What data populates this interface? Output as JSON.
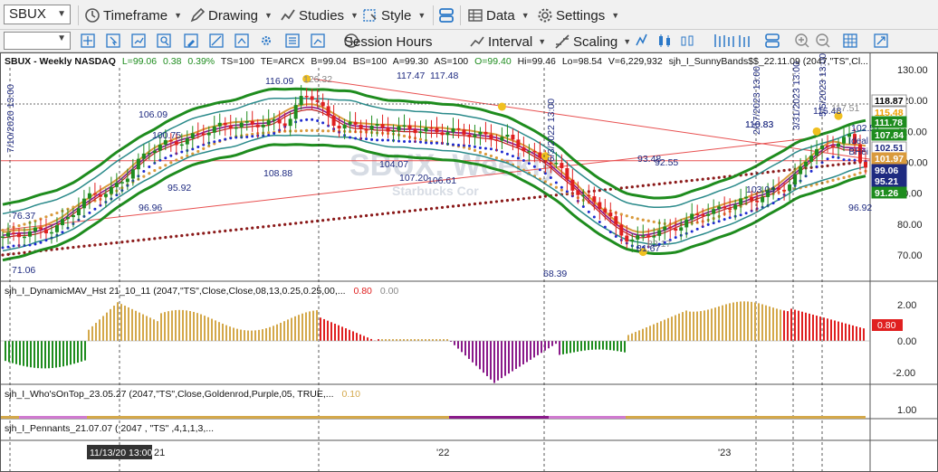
{
  "toolbar": {
    "symbol": "SBUX",
    "timeframe": "Timeframe",
    "drawing": "Drawing",
    "studies": "Studies",
    "style": "Style",
    "data": "Data",
    "settings": "Settings",
    "session_hours": "Session Hours",
    "interval": "Interval",
    "scaling": "Scaling"
  },
  "header": {
    "symbol": "SBUX - Weekly  NASDAQ",
    "L": "L=99.06",
    "chg": "0.38",
    "pct": "0.39%",
    "ts": "TS=100",
    "te": "TE=ARCX",
    "b": "B=99.04",
    "bs": "BS=100",
    "a": "A=99.30",
    "as": "AS=100",
    "o": "O=99.40",
    "hi": "Hi=99.46",
    "lo": "Lo=98.54",
    "v": "V=6,229,932",
    "study": "sjh_I_SunnyBands$$_22.11.09 (2047,\"TS\",Cl..."
  },
  "watermark": {
    "symbol": "SBUX, Weekly",
    "name": "Starbucks Cor"
  },
  "price_axis": {
    "ticks": [
      "130.00",
      "120.00",
      "110.00",
      "100.00",
      "90.00",
      "80.00",
      "70.00"
    ],
    "badges": [
      {
        "value": "118.87",
        "bg": "#ffffff",
        "fg": "#000000"
      },
      {
        "value": "115.48",
        "bg": "#ffffff",
        "fg": "#f0a000"
      },
      {
        "value": "111.78",
        "bg": "#1e8c1e",
        "fg": "#ffffff"
      },
      {
        "value": "107.84",
        "bg": "#1e8c1e",
        "fg": "#ffffff"
      },
      {
        "value": "102.51",
        "bg": "#ffffff",
        "fg": "#1e2a80"
      },
      {
        "value": "101.97",
        "bg": "#d99a3c",
        "fg": "#ffffff"
      },
      {
        "value": "99.06",
        "bg": "#1e2a80",
        "fg": "#ffffff"
      },
      {
        "value": "95.21",
        "bg": "#1e2a80",
        "fg": "#ffffff"
      },
      {
        "value": "91.26",
        "bg": "#1e8c1e",
        "fg": "#ffffff"
      }
    ]
  },
  "annotations": {
    "price_labels": [
      "126.32",
      "116.09",
      "117.47",
      "117.48",
      "106.09",
      "100.75",
      "95.92",
      "96.96",
      "76.37",
      "71.06",
      "108.88",
      "107.20",
      "106.61",
      "104.07",
      "68.39",
      "83.17",
      "81.67",
      "93.48",
      "92.55",
      "110.83",
      "110.83",
      "103.04",
      "115.48",
      "102.51",
      "96.92",
      "117.51"
    ],
    "date_labels": [
      "7/10/2020 13:00",
      "6/3/2022 13:00",
      "2/17/2023 13:00",
      "3/31/2023 13:00",
      "5/5/2023 13:00"
    ],
    "note": "Ideal",
    "note2": "BHei"
  },
  "panels": {
    "dynamic_mav": {
      "title": "sjh_I_DynamicMAV_Hst 21_10_11 (2047,\"TS\",Close,Close,08,13,0.25,0.25,00,...",
      "v1": "0.80",
      "v2": "0.00",
      "ticks": [
        "2.00",
        "0.00",
        "-2.00"
      ],
      "badge": "0.80"
    },
    "whos_on_top": {
      "title": "sjh_I_Who'sOnTop_23.05.27 (2047,\"TS\",Close,Goldenrod,Purple,05,  TRUE,...",
      "v1": "0.10",
      "ticks": [
        "1.00"
      ]
    },
    "pennants": {
      "title": "sjh_I_Pennants_21.07.07 ( 2047 , \"TS\" ,4,1,1,3,..."
    }
  },
  "time_axis": {
    "cursor_label": "11/13/20 13:00",
    "labels": [
      "21",
      "'22",
      "'23"
    ]
  },
  "colors": {
    "green_band": "#1e8c1e",
    "teal_band": "#2a8a8a",
    "orange_dots": "#d99a3c",
    "maroon_dots": "#8b1a1a",
    "blue_dots": "#1e2ad0",
    "up_candle": "#1e8c1e",
    "down_candle": "#e02020",
    "hist_gold": "#d4a84a",
    "hist_red": "#e02020",
    "hist_green": "#1e8c1e",
    "hist_purple": "#8a1a8a"
  }
}
